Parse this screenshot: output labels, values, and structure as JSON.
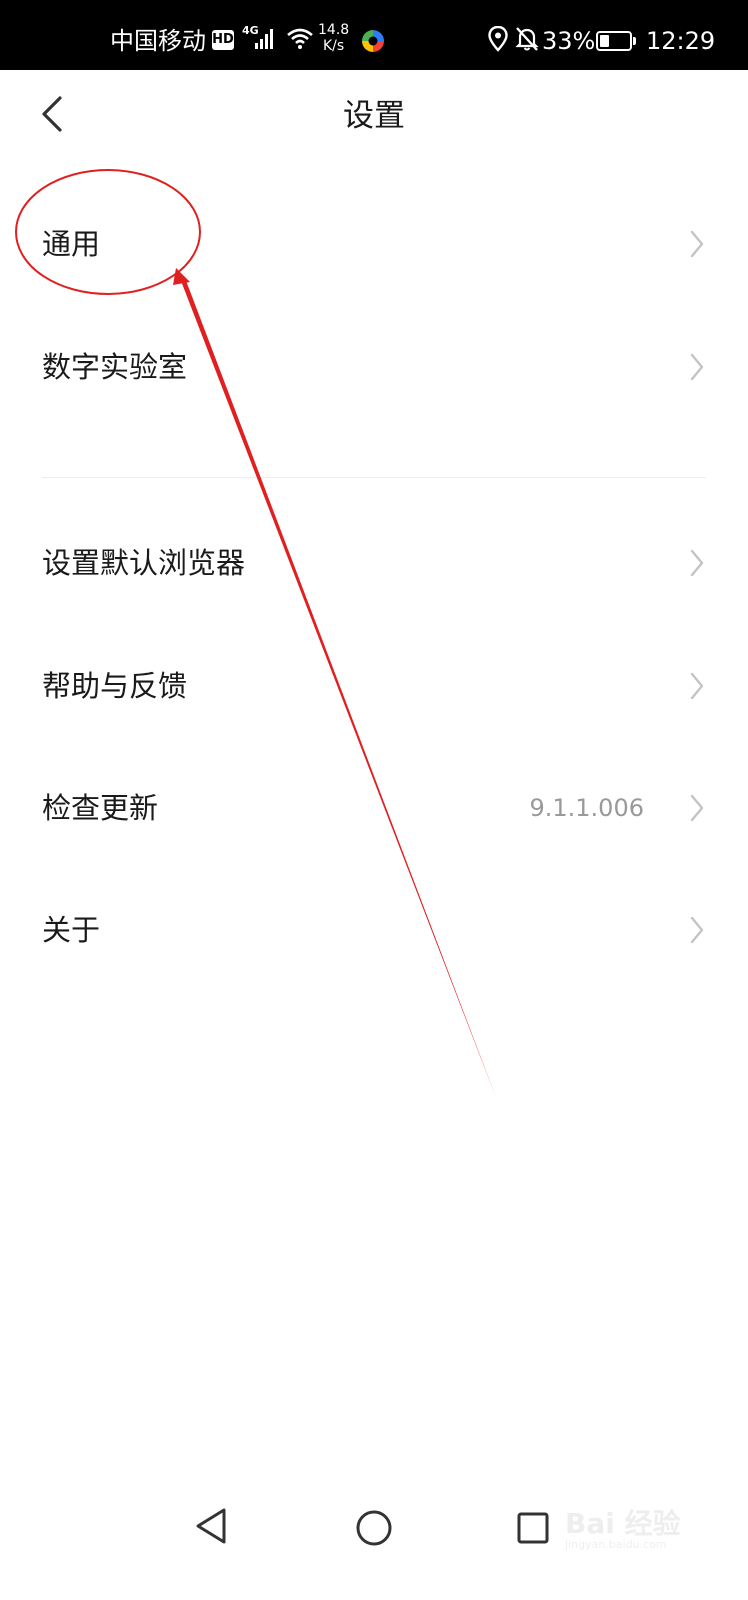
{
  "status_bar": {
    "carrier": "中国移动",
    "hd": "HD",
    "network": "4G",
    "speed_value": "14.8",
    "speed_unit": "K/s",
    "battery_percent": "33%",
    "battery_level": 0.33,
    "time": "12:29"
  },
  "header": {
    "title": "设置"
  },
  "menu": {
    "items": [
      {
        "label": "通用"
      },
      {
        "label": "数字实验室"
      },
      {
        "label": "设置默认浏览器"
      },
      {
        "label": "帮助与反馈"
      },
      {
        "label": "检查更新",
        "value": "9.1.1.006"
      },
      {
        "label": "关于"
      }
    ]
  },
  "watermark": {
    "text": "Bai 经验",
    "url": "jingyan.baidu.com"
  },
  "colors": {
    "annotation": "#e02020",
    "text": "#1a1a1a",
    "muted": "#999999",
    "chevron": "#c4c4c4",
    "status_bar_bg": "#000000"
  }
}
